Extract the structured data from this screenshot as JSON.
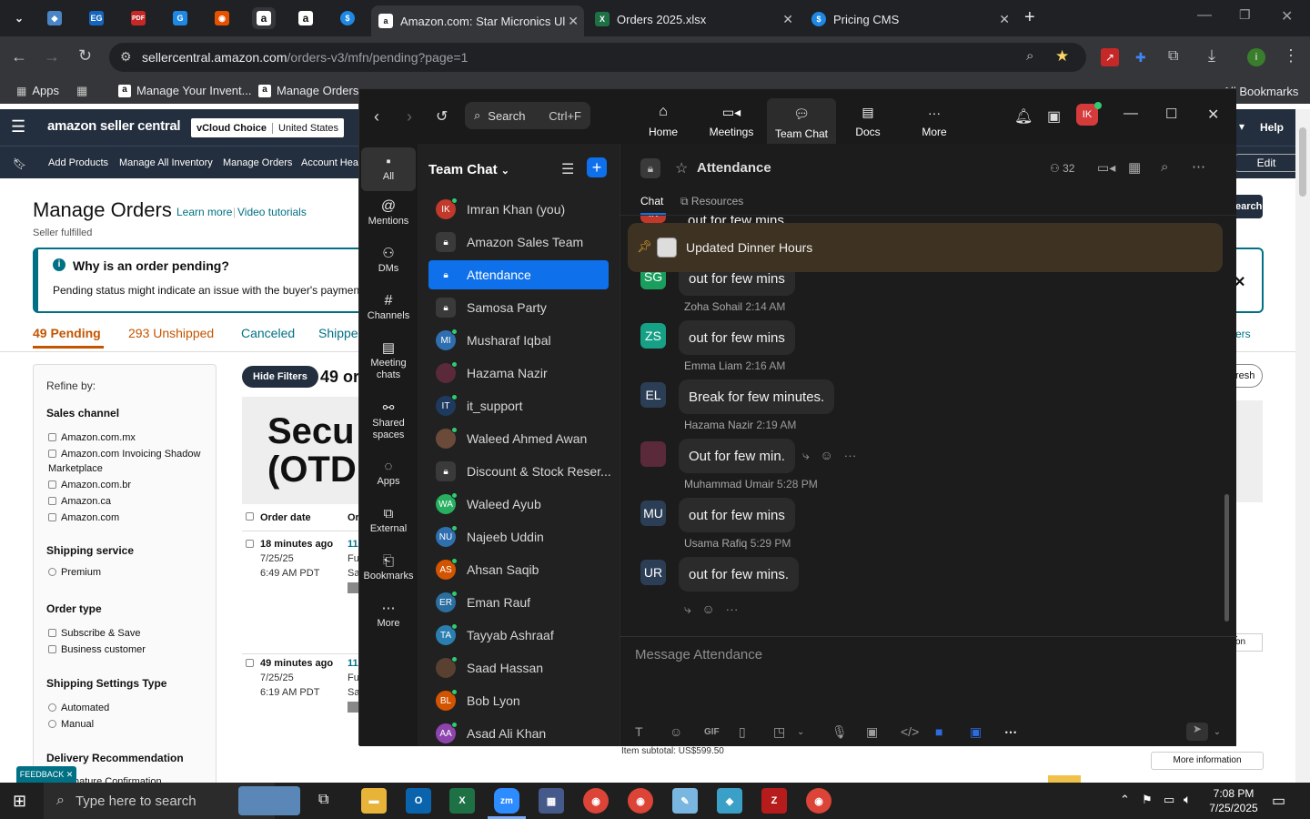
{
  "browser": {
    "tabs": [
      {
        "title": "Amazon.com: Star Micronics Ul",
        "active": true
      },
      {
        "title": "Orders 2025.xlsx"
      },
      {
        "title": "Pricing CMS"
      }
    ],
    "pinned_icons": [
      "EG",
      "PDF",
      "G",
      "a",
      "a",
      "$"
    ],
    "url_host": "sellercentral.amazon.com",
    "url_path": "/orders-v3/mfn/pending?page=1",
    "bookmarks": {
      "apps": "Apps",
      "items": [
        "Manage Your Invent...",
        "Manage Orders"
      ],
      "all": "All Bookmarks"
    }
  },
  "amazon": {
    "logo": "amazon seller central",
    "account_left": "vCloud Choice",
    "account_right": "United States",
    "help": "Help",
    "nav": [
      "Add Products",
      "Manage All Inventory",
      "Manage Orders",
      "Account Heal"
    ],
    "edit": "Edit",
    "page_title": "Manage Orders",
    "learn_more": "Learn more",
    "video_tutorials": "Video tutorials",
    "subtitle": "Seller fulfilled",
    "alert_title": "Why is an order pending?",
    "alert_text": "Pending status might indicate an issue with the buyer's payment m",
    "tabs": [
      "49 Pending",
      "293 Unshipped",
      "Canceled",
      "Shippe"
    ],
    "refine": "Refine by:",
    "sales_channel": "Sales channel",
    "channels": [
      "Amazon.com.mx",
      "Amazon.com Invoicing Shadow Marketplace",
      "Amazon.com.br",
      "Amazon.ca",
      "Amazon.com"
    ],
    "shipping_service": "Shipping service",
    "premium": "Premium",
    "order_type": "Order type",
    "order_types": [
      "Subscribe & Save",
      "Business customer"
    ],
    "shipping_settings": "Shipping Settings Type",
    "shipping_types": [
      "Automated",
      "Manual"
    ],
    "delivery_rec": "Delivery Recommendation",
    "delivery_sub": "nature Confirmation",
    "hide_filters": "Hide Filters",
    "count_prefix": "49 or",
    "banner_text_1": "Secu",
    "banner_text_2": "(OTD",
    "col_order_date": "Order date",
    "col_or": "Or",
    "orders": [
      {
        "ago": "18 minutes ago",
        "date": "7/25/25",
        "time": "6:49 AM PDT",
        "id": "11",
        "a": "Fu",
        "b": "Sa"
      },
      {
        "ago": "49 minutes ago",
        "date": "7/25/25",
        "time": "6:19 AM PDT",
        "id": "11",
        "a": "Fu",
        "b": "Sa"
      }
    ],
    "right_search": "earch",
    "right_tab": "ers",
    "right_refresh": "resh",
    "right_on": "on",
    "item_subtotal": "Item subtotal: US$599.50",
    "more_info": "More information",
    "feedback": "FEEDBACK"
  },
  "zoom": {
    "nav": [
      "Home",
      "Meetings",
      "Team Chat",
      "Docs",
      "More"
    ],
    "search": "Search",
    "search_shortcut": "Ctrl+F",
    "user_initials": "IK",
    "rail": [
      "All",
      "Mentions",
      "DMs",
      "Channels",
      "Meeting chats",
      "Shared spaces",
      "Apps",
      "External",
      "Bookmarks",
      "More"
    ],
    "list_title": "Team Chat",
    "channels": [
      {
        "name": "Imran Khan (you)",
        "initials": "IK",
        "color": "#c0392b"
      },
      {
        "name": "Amazon Sales Team",
        "initials": "",
        "color": "lock"
      },
      {
        "name": "Attendance",
        "initials": "",
        "color": "lock",
        "selected": true
      },
      {
        "name": "Samosa Party",
        "initials": "",
        "color": "lock"
      },
      {
        "name": "Musharaf Iqbal",
        "initials": "MI",
        "color": "#2f6fb0"
      },
      {
        "name": "Hazama Nazir",
        "initials": "",
        "color": "#5a2a3a"
      },
      {
        "name": "it_support",
        "initials": "IT",
        "color": "#1e3a5f"
      },
      {
        "name": "Waleed Ahmed Awan",
        "initials": "",
        "color": "#6b4a3a"
      },
      {
        "name": "Discount & Stock Reser...",
        "initials": "",
        "color": "lock"
      },
      {
        "name": "Waleed Ayub",
        "initials": "WA",
        "color": "#27ae60"
      },
      {
        "name": "Najeeb Uddin",
        "initials": "NU",
        "color": "#2f6fb0"
      },
      {
        "name": "Ahsan Saqib",
        "initials": "AS",
        "color": "#d35400"
      },
      {
        "name": "Eman Rauf",
        "initials": "ER",
        "color": "#2a6fa0"
      },
      {
        "name": "Tayyab Ashraaf",
        "initials": "TA",
        "color": "#2a7fb0"
      },
      {
        "name": "Saad Hassan",
        "initials": "",
        "color": "#5a4030"
      },
      {
        "name": "Bob Lyon",
        "initials": "BL",
        "color": "#d35400"
      },
      {
        "name": "Asad Ali Khan",
        "initials": "AA",
        "color": "#8e44ad"
      }
    ],
    "channel_name": "Attendance",
    "member_count": "32",
    "chat_tab": "Chat",
    "resources_tab": "Resources",
    "pinned": "Updated Dinner Hours",
    "cutoff_msg": "out for few mins",
    "messages": [
      {
        "initials": "SG",
        "color": "#1a9e5e",
        "author": "",
        "time": "",
        "text": "out for few mins"
      },
      {
        "initials": "ZS",
        "color": "#16a085",
        "author": "Zoha Sohail",
        "time": "2:14 AM",
        "text": "out for few mins"
      },
      {
        "initials": "EL",
        "color": "#2c3e55",
        "author": "Emma Liam",
        "time": "2:16 AM",
        "text": "Break for few minutes."
      },
      {
        "initials": "",
        "color": "#5a2a3a",
        "author": "Hazama Nazir",
        "time": "2:19 AM",
        "text": "Out for few min."
      },
      {
        "initials": "MU",
        "color": "#2c3e55",
        "author": "Muhammad Umair",
        "time": "5:28 PM",
        "text": "out for few mins"
      },
      {
        "initials": "UR",
        "color": "#2c3e55",
        "author": "Usama Rafiq",
        "time": "5:29 PM",
        "text": "out for few mins."
      }
    ],
    "composer_placeholder": "Message Attendance"
  },
  "taskbar": {
    "search_placeholder": "Type here to search",
    "time": "7:08 PM",
    "date": "7/25/2025"
  }
}
